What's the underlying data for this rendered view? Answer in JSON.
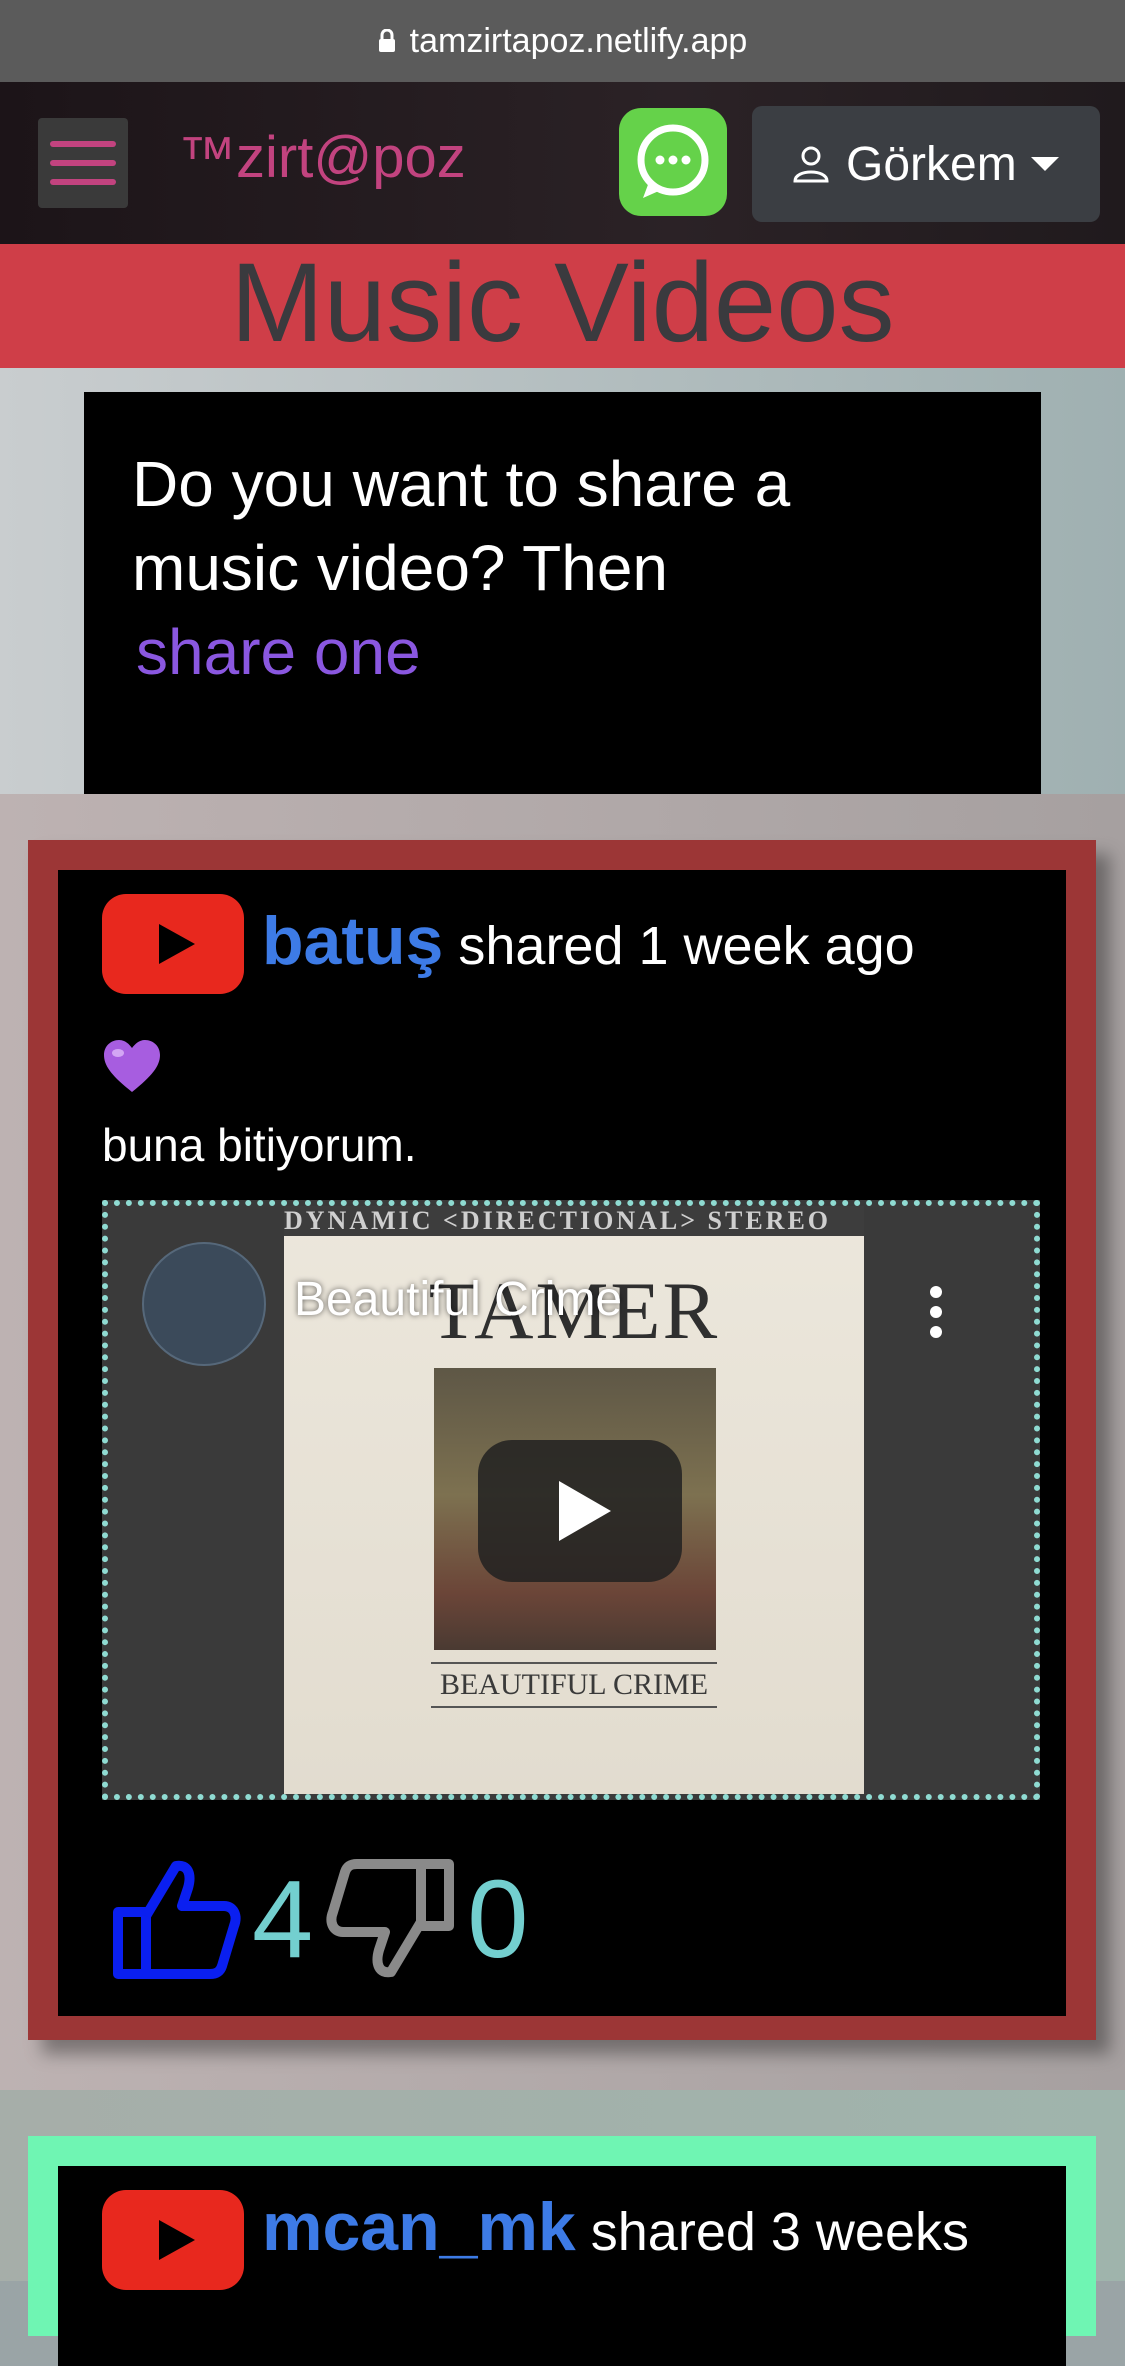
{
  "browser": {
    "url": "tamzirtapoz.netlify.app"
  },
  "nav": {
    "brand": "™zirt@poz",
    "user_name": "Görkem"
  },
  "page": {
    "heading": "Music Videos",
    "share_prompt": "Do you want to share a music video? Then",
    "share_link": "share one"
  },
  "posts": [
    {
      "user": "batuş",
      "shared_text": "shared 1 week ago",
      "emoji": "💜",
      "caption": "buna bitiyorum.",
      "video": {
        "title": "Beautiful Crime",
        "cover_top_strip": "DYNAMIC  <DIRECTIONAL>  STEREO",
        "cover_artist": "TAMER",
        "cover_album": "BEAUTIFUL CRIME"
      },
      "likes": "4",
      "dislikes": "0",
      "frame_color": "#9c3636"
    },
    {
      "user": "mcan_mk",
      "shared_text": "shared 3 weeks",
      "frame_color": "#6ff5b3"
    }
  ],
  "colors": {
    "brand": "#c2437f",
    "heading_bg": "#cf3e48",
    "link": "#8a57e0",
    "username": "#3d7be6",
    "count": "#73cfcf"
  }
}
